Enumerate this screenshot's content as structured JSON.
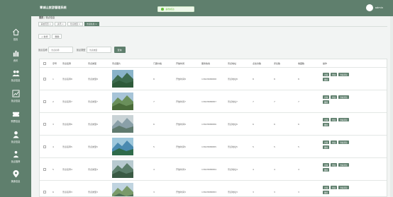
{
  "header": {
    "title": "青城山旅游管理系统",
    "username": "admin"
  },
  "toast": {
    "text": "操作成功"
  },
  "sidebar": {
    "items": [
      {
        "label": "首页",
        "icon": "home-icon"
      },
      {
        "label": "资讯",
        "icon": "chart-icon"
      },
      {
        "label": "景点信息",
        "icon": "users-icon"
      },
      {
        "label": "景点信息",
        "icon": "trend-icon"
      },
      {
        "label": "购票信息",
        "icon": "ticket-icon"
      },
      {
        "label": "景点信息",
        "icon": "person-icon"
      },
      {
        "label": "景点推荐",
        "icon": "people-icon"
      },
      {
        "label": "美食信息",
        "icon": "pin-icon"
      }
    ]
  },
  "breadcrumb": {
    "home": "首页",
    "current": "景点信息"
  },
  "tabs": [
    {
      "label": "系统首页 ×"
    },
    {
      "label": "资讯 ×"
    },
    {
      "label": "景点类型 ×"
    },
    {
      "label": "景点信息 ×"
    }
  ],
  "toolbar": {
    "add": "+ 新增",
    "delete": "删除"
  },
  "search": {
    "label1": "景点名称",
    "placeholder1": "景点名称",
    "label2": "景点类型",
    "placeholder2": "景点类型",
    "button": "查询"
  },
  "columns": [
    "",
    "序号",
    "景点名称",
    "景点类型",
    "景点图片",
    "门票价格",
    "开放时间",
    "服务热线",
    "景点地址",
    "点击次数",
    "评论数",
    "收藏数",
    "操作"
  ],
  "actions": {
    "detail": "详情",
    "edit": "修改",
    "review": "查看评论",
    "delete": "删除"
  },
  "rows": [
    {
      "idx": "1",
      "name": "景点名称8",
      "type": "景点类型8",
      "price": "8",
      "time": "开放时间8",
      "phone": "13823888888",
      "addr": "景点地址8",
      "clicks": "8",
      "comments": "8",
      "favs": "8"
    },
    {
      "idx": "2",
      "name": "景点名称7",
      "type": "景点类型7",
      "price": "7",
      "time": "开放时间7",
      "phone": "13823888887",
      "addr": "景点地址7",
      "clicks": "7",
      "comments": "7",
      "favs": "7"
    },
    {
      "idx": "3",
      "name": "景点名称6",
      "type": "景点类型6",
      "price": "6",
      "time": "开放时间6",
      "phone": "13823888886",
      "addr": "景点地址6",
      "clicks": "6",
      "comments": "6",
      "favs": "6"
    },
    {
      "idx": "4",
      "name": "景点名称5",
      "type": "景点类型5",
      "price": "5",
      "time": "开放时间5",
      "phone": "13823888885",
      "addr": "景点地址5",
      "clicks": "5",
      "comments": "5",
      "favs": "5"
    },
    {
      "idx": "5",
      "name": "景点名称4",
      "type": "景点类型4",
      "price": "4",
      "time": "开放时间4",
      "phone": "13823888884",
      "addr": "景点地址4",
      "clicks": "4",
      "comments": "4",
      "favs": "4"
    },
    {
      "idx": "6",
      "name": "景点名称3",
      "type": "景点类型3",
      "price": "3",
      "time": "开放时间3",
      "phone": "13823888883",
      "addr": "景点地址3",
      "clicks": "3",
      "comments": "3",
      "favs": "3"
    }
  ]
}
